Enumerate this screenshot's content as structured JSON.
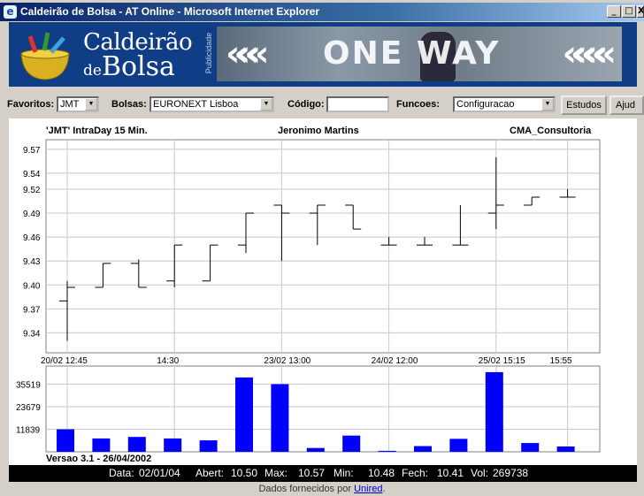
{
  "window": {
    "title": "Caldeirão de Bolsa - AT Online - Microsoft Internet Explorer",
    "icon": "ie-icon",
    "controls": {
      "minimize": "_",
      "maximize": "□",
      "close": "X"
    }
  },
  "banner": {
    "logo_line1": "Caldeirão",
    "logo_de": "de",
    "logo_bolsa": "Bolsa",
    "publicidade": "Publicidade",
    "ad_text": "ONE WAY",
    "ad_chevrons_left": "«««",
    "ad_chevrons_right": "««««"
  },
  "toolbar": {
    "favoritos_label": "Favoritos:",
    "favoritos_value": "JMT",
    "bolsas_label": "Bolsas:",
    "bolsas_value": "EURONEXT Lisboa",
    "codigo_label": "Código:",
    "codigo_value": "",
    "funcoes_label": "Funcoes:",
    "funcoes_value": "Configuracao",
    "estudos_button": "Estudos",
    "ajuda_button": "Ajud"
  },
  "chart_header": {
    "left": "'JMT'  IntraDay 15 Min.",
    "center": "Jeronimo Martins",
    "right": "CMA_Consultoria"
  },
  "chart_data": [
    {
      "type": "ohlc",
      "title": "'JMT'  IntraDay 15 Min.",
      "yticks": [
        9.34,
        9.37,
        9.4,
        9.43,
        9.46,
        9.49,
        9.52,
        9.54,
        9.57
      ],
      "ylim": [
        9.315,
        9.582
      ],
      "xticks": [
        "20/02 12:45",
        "14:30",
        "23/02 13:00",
        "24/02 12:00",
        "25/02 15:15",
        "15:55"
      ],
      "grid": true,
      "bars": [
        {
          "open": 9.38,
          "high": 9.405,
          "low": 9.33,
          "close": 9.397
        },
        {
          "open": 9.397,
          "high": 9.427,
          "low": 9.397,
          "close": 9.427
        },
        {
          "open": 9.427,
          "high": 9.432,
          "low": 9.397,
          "close": 9.397
        },
        {
          "open": 9.405,
          "high": 9.45,
          "low": 9.397,
          "close": 9.45
        },
        {
          "open": 9.405,
          "high": 9.45,
          "low": 9.405,
          "close": 9.45
        },
        {
          "open": 9.45,
          "high": 9.49,
          "low": 9.44,
          "close": 9.49
        },
        {
          "open": 9.5,
          "high": 9.5,
          "low": 9.43,
          "close": 9.49
        },
        {
          "open": 9.49,
          "high": 9.5,
          "low": 9.45,
          "close": 9.5
        },
        {
          "open": 9.5,
          "high": 9.5,
          "low": 9.47,
          "close": 9.47
        },
        {
          "open": 9.45,
          "high": 9.46,
          "low": 9.45,
          "close": 9.45
        },
        {
          "open": 9.45,
          "high": 9.46,
          "low": 9.45,
          "close": 9.45
        },
        {
          "open": 9.45,
          "high": 9.5,
          "low": 9.45,
          "close": 9.45
        },
        {
          "open": 9.49,
          "high": 9.56,
          "low": 9.47,
          "close": 9.5
        },
        {
          "open": 9.5,
          "high": 9.51,
          "low": 9.5,
          "close": 9.51
        },
        {
          "open": 9.51,
          "high": 9.52,
          "low": 9.51,
          "close": 9.51
        }
      ]
    },
    {
      "type": "bar",
      "title": "Volume",
      "yticks": [
        11839,
        23679,
        35519
      ],
      "ylim": [
        0,
        45000
      ],
      "values": [
        11800,
        7000,
        7800,
        7000,
        6000,
        39000,
        35500,
        2000,
        8500,
        500,
        3000,
        6800,
        41800,
        4600,
        2800
      ],
      "color": "#0000ff"
    }
  ],
  "version_text": "Versao 3.1 - 26/04/2002",
  "info_bar": {
    "data_label": "Data:",
    "data_value": "02/01/04",
    "abert_label": "Abert:",
    "abert_value": "10.50",
    "max_label": "Max:",
    "max_value": "10.57",
    "min_label": "Min:",
    "min_value": "10.48",
    "fech_label": "Fech:",
    "fech_value": "10.41",
    "vol_label": "Vol:",
    "vol_value": "269738"
  },
  "footer": {
    "prefix": "Dados fornecidos por ",
    "link": "Unired",
    "suffix": "."
  }
}
